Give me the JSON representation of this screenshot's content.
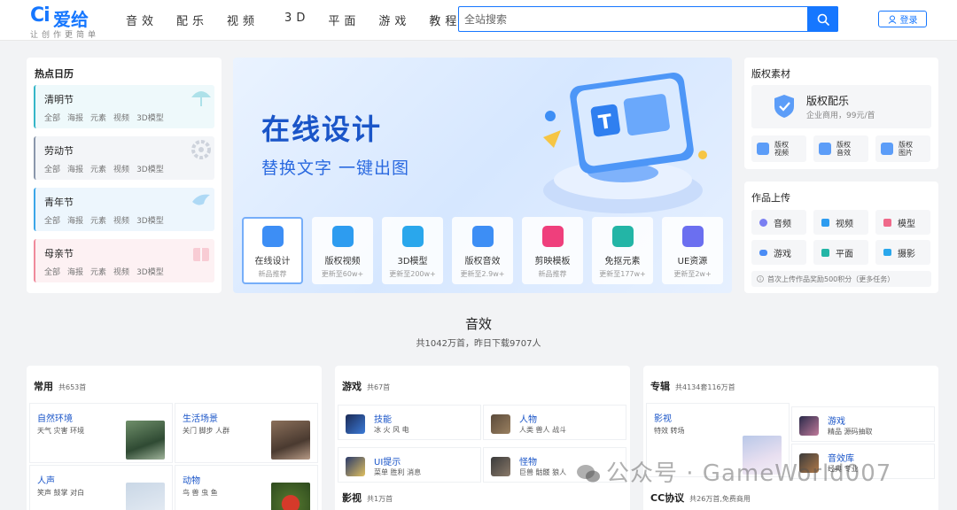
{
  "header": {
    "logo_mark": "Ci",
    "logo_text": "爱给",
    "slogan": "让创作更简单",
    "nav": [
      "音效",
      "配乐",
      "视频",
      "3D",
      "平面",
      "游戏",
      "教程"
    ],
    "search_placeholder": "全站搜索",
    "login_label": "登录"
  },
  "calendar": {
    "title": "热点日历",
    "items": [
      {
        "name": "清明节",
        "tags": [
          "全部",
          "海报",
          "元素",
          "视频",
          "3D模型"
        ],
        "accent": "#36b6c8",
        "bg": "#eef9fb"
      },
      {
        "name": "劳动节",
        "tags": [
          "全部",
          "海报",
          "元素",
          "视频",
          "3D模型"
        ],
        "accent": "#8a97ab",
        "bg": "#f3f5f8"
      },
      {
        "name": "青年节",
        "tags": [
          "全部",
          "海报",
          "元素",
          "视频",
          "3D模型"
        ],
        "accent": "#3ba6e8",
        "bg": "#edf6fd"
      },
      {
        "name": "母亲节",
        "tags": [
          "全部",
          "海报",
          "元素",
          "视频",
          "3D模型"
        ],
        "accent": "#f08a9b",
        "bg": "#fdf1f3"
      }
    ]
  },
  "banner": {
    "title": "在线设计",
    "subtitle": "替换文字 一键出图",
    "tiles": [
      {
        "name": "在线设计",
        "sub": "新品推荐",
        "color": "#3d8ef5"
      },
      {
        "name": "版权视频",
        "sub": "更新至60w+",
        "color": "#2d9cf0"
      },
      {
        "name": "3D模型",
        "sub": "更新至200w+",
        "color": "#2aa7ec"
      },
      {
        "name": "版权音效",
        "sub": "更新至2.9w+",
        "color": "#3d8ef5"
      },
      {
        "name": "剪映模板",
        "sub": "新品推荐",
        "color": "#ef3f7c"
      },
      {
        "name": "免抠元素",
        "sub": "更新至177w+",
        "color": "#23b5a6"
      },
      {
        "name": "UE资源",
        "sub": "更新至2w+",
        "color": "#6b6ff0"
      }
    ]
  },
  "copyright": {
    "title": "版权素材",
    "main_title": "版权配乐",
    "main_sub": "企业商用，99元/首",
    "subs": [
      "版权视频",
      "版权音效",
      "版权图片"
    ]
  },
  "upload": {
    "title": "作品上传",
    "items": [
      "音频",
      "视频",
      "模型",
      "游戏",
      "平面",
      "摄影"
    ],
    "note": "首次上传作品奖励500积分（更多任务）"
  },
  "section": {
    "title": "音效",
    "subtitle": "共1042万首，昨日下载9707人"
  },
  "panels": {
    "common": {
      "title": "常用",
      "count": "共653首",
      "cells": [
        {
          "title": "自然环境",
          "desc": "天气 灾害 环境"
        },
        {
          "title": "生活场景",
          "desc": "关门 脚步 人群"
        },
        {
          "title": "人声",
          "desc": "笑声 鼓掌 对白"
        },
        {
          "title": "动物",
          "desc": "鸟 兽 虫 鱼"
        }
      ]
    },
    "game": {
      "title": "游戏",
      "count": "共67首",
      "rows": [
        {
          "title": "技能",
          "desc": "冰 火 风 电"
        },
        {
          "title": "人物",
          "desc": "人类 兽人 战斗"
        },
        {
          "title": "UI提示",
          "desc": "菜单 胜利 消息"
        },
        {
          "title": "怪物",
          "desc": "巨兽 骷髅 狼人"
        }
      ],
      "next_title": "影视",
      "next_count": "共1万首"
    },
    "album": {
      "title": "专辑",
      "count": "共4134套116万首",
      "cells": [
        {
          "title": "影视",
          "desc": "特效 转场"
        },
        {
          "title": "游戏",
          "desc": "精品 源码抽取"
        },
        {
          "title": "音效库",
          "desc": "经典 专业"
        }
      ],
      "next_title": "CC协议",
      "next_count": "共26万首,免费商用"
    }
  },
  "watermark": "公众号 · GameWorld007"
}
